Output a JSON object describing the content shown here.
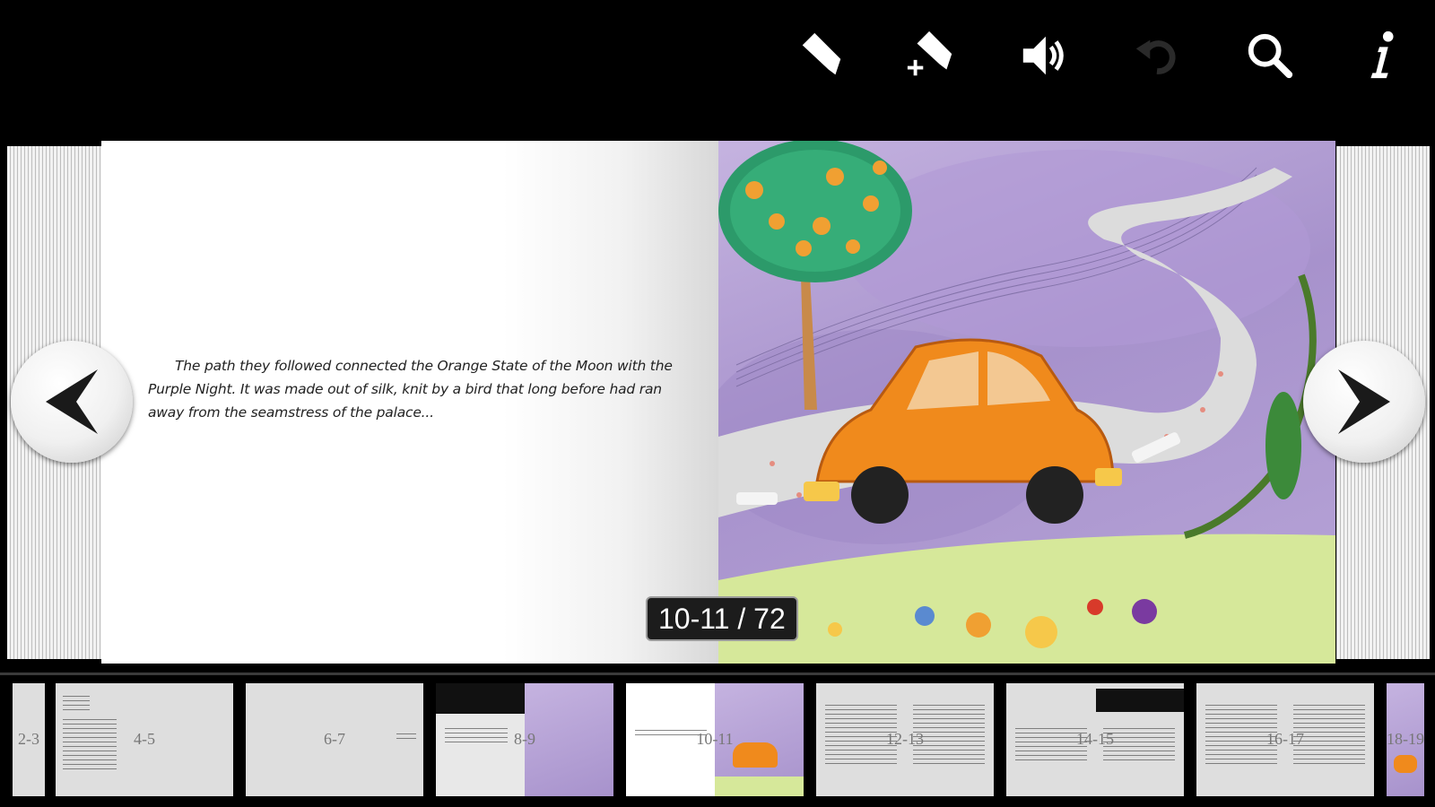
{
  "toolbar": {
    "buttons": [
      {
        "icon": "bookmark-icon"
      },
      {
        "icon": "add-bookmark-icon"
      },
      {
        "icon": "volume-icon"
      },
      {
        "icon": "undo-icon"
      },
      {
        "icon": "search-icon"
      },
      {
        "icon": "info-icon"
      }
    ]
  },
  "book": {
    "left_page_text": "The path they followed connected the Orange State of the Moon with the Purple Night. It was made out of silk, knit by a bird that long before had ran away from the seamstress of the palace...",
    "page_counter": "10-11 / 72"
  },
  "nav": {
    "prev_icon": "arrow-left-icon",
    "next_icon": "arrow-right-icon"
  },
  "thumbnails": [
    {
      "label": "2-3"
    },
    {
      "label": "4-5"
    },
    {
      "label": "6-7"
    },
    {
      "label": "8-9"
    },
    {
      "label": "10-11"
    },
    {
      "label": "12-13"
    },
    {
      "label": "14-15"
    },
    {
      "label": "16-17"
    },
    {
      "label": "18-19"
    }
  ],
  "colors": {
    "background": "#000000",
    "page_white": "#ffffff",
    "illustration_purple": "#a792cc",
    "car_orange": "#f08a1c",
    "grass_green": "#d6e89a"
  }
}
